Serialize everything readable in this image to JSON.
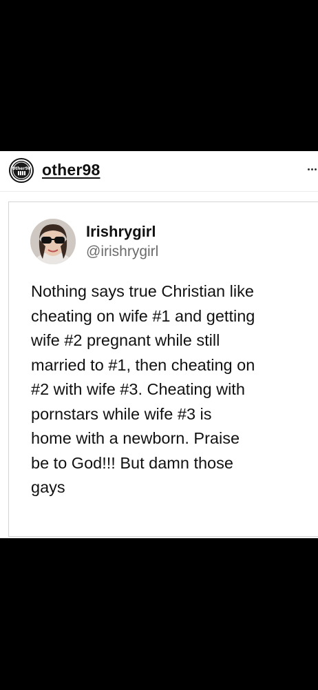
{
  "post": {
    "account_name": "other98",
    "account_avatar_text": "Other98",
    "more_icon": "more-horizontal-icon"
  },
  "tweet": {
    "display_name": "Irishrygirl",
    "handle": "@irishrygirl",
    "text": "Nothing says true Christian like\ncheating on wife #1 and getting\nwife #2 pregnant while still\nmarried to #1, then cheating on\n#2 with wife #3. Cheating with\npornstars while wife #3 is\nhome with a newborn. Praise\nbe to God!!! But damn those\ngays"
  }
}
